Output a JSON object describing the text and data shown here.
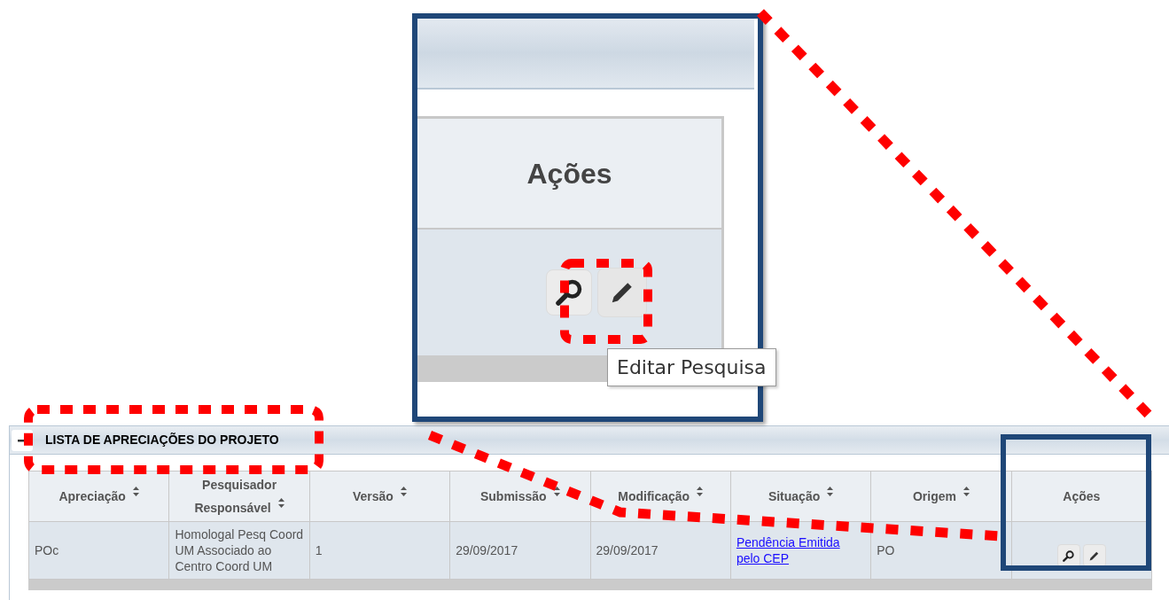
{
  "inset": {
    "header": "Ações",
    "tooltip": "Editar Pesquisa"
  },
  "panel": {
    "title": "LISTA DE APRECIAÇÕES DO PROJETO",
    "expanded": true,
    "columns": [
      {
        "label": "Apreciação",
        "sortable": true
      },
      {
        "label": "Pesquisador Responsável",
        "sortable": true
      },
      {
        "label": "Versão",
        "sortable": true
      },
      {
        "label": "Submissão",
        "sortable": true
      },
      {
        "label": "Modificação",
        "sortable": true
      },
      {
        "label": "Situação",
        "sortable": true
      },
      {
        "label": "Origem",
        "sortable": true
      },
      {
        "label": "Ações",
        "sortable": false
      }
    ],
    "rows": [
      {
        "cells": [
          {
            "kind": "text",
            "text": "POc"
          },
          {
            "kind": "text",
            "text": "Homologal Pesq Coord UM Associado ao Centro Coord UM"
          },
          {
            "kind": "text",
            "text": "1"
          },
          {
            "kind": "text",
            "text": "29/09/2017"
          },
          {
            "kind": "text",
            "text": "29/09/2017"
          },
          {
            "kind": "link",
            "text": "Pendência Emitida pelo CEP"
          },
          {
            "kind": "text",
            "text": "PO"
          },
          {
            "kind": "actions"
          }
        ]
      }
    ]
  }
}
